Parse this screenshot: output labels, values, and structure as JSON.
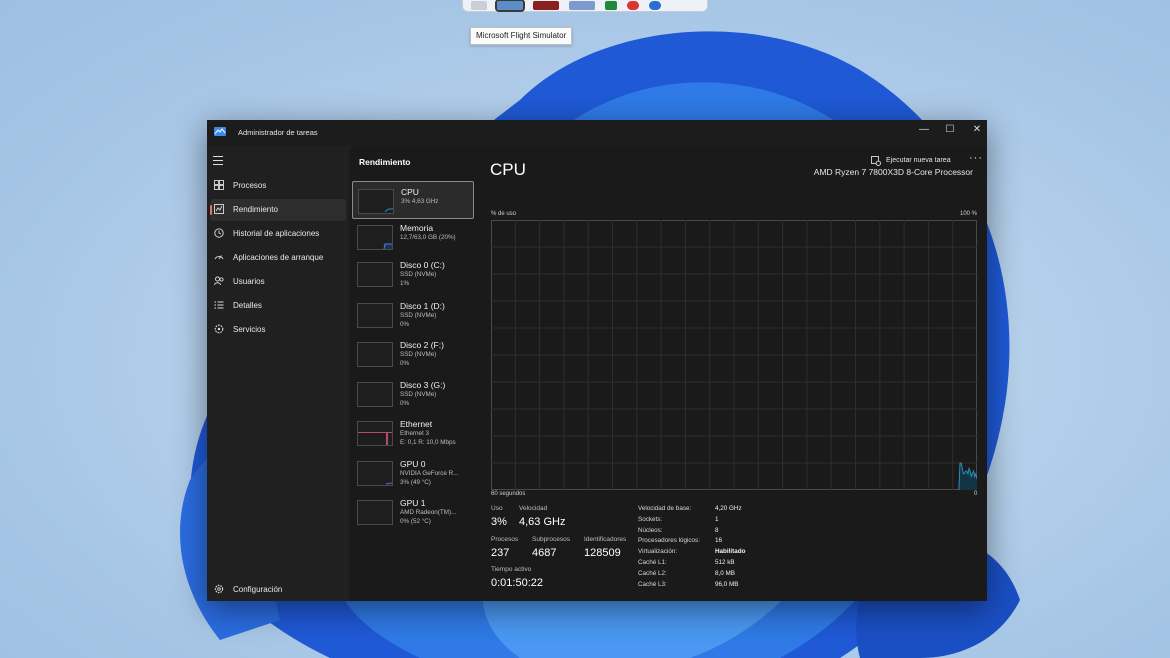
{
  "taskbar": {
    "tooltip": "Microsoft Flight Simulator"
  },
  "window": {
    "title": "Administrador de tareas",
    "controls": {
      "minimize": "—",
      "maximize": "☐",
      "close": "✕"
    }
  },
  "nav": {
    "items": [
      {
        "label": "Procesos",
        "icon": "processes-icon",
        "selected": false
      },
      {
        "label": "Rendimiento",
        "icon": "performance-icon",
        "selected": true
      },
      {
        "label": "Historial de aplicaciones",
        "icon": "history-icon",
        "selected": false
      },
      {
        "label": "Aplicaciones de arranque",
        "icon": "startup-icon",
        "selected": false
      },
      {
        "label": "Usuarios",
        "icon": "users-icon",
        "selected": false
      },
      {
        "label": "Detalles",
        "icon": "details-icon",
        "selected": false
      },
      {
        "label": "Servicios",
        "icon": "services-icon",
        "selected": false
      }
    ],
    "settings": {
      "label": "Configuración",
      "icon": "gear-icon"
    }
  },
  "content": {
    "page_title": "Rendimiento",
    "run_task": "Ejecutar nueva tarea",
    "more": "···"
  },
  "resources": [
    {
      "name": "CPU",
      "sub1": "3% 4,63 GHz",
      "sub2": ""
    },
    {
      "name": "Memoria",
      "sub1": "12,7/63,0 GB (20%)",
      "sub2": ""
    },
    {
      "name": "Disco 0 (C:)",
      "sub1": "SSD (NVMe)",
      "sub2": "1%"
    },
    {
      "name": "Disco 1 (D:)",
      "sub1": "SSD (NVMe)",
      "sub2": "0%"
    },
    {
      "name": "Disco 2 (F:)",
      "sub1": "SSD (NVMe)",
      "sub2": "0%"
    },
    {
      "name": "Disco 3 (G:)",
      "sub1": "SSD (NVMe)",
      "sub2": "0%"
    },
    {
      "name": "Ethernet",
      "sub1": "Ethernet 3",
      "sub2": "E: 0,1 R: 10,0 Mbps"
    },
    {
      "name": "GPU 0",
      "sub1": "NVIDIA GeForce R...",
      "sub2": "3% (49 °C)"
    },
    {
      "name": "GPU 1",
      "sub1": "AMD Radeon(TM)...",
      "sub2": "0% (52 °C)"
    }
  ],
  "cpu": {
    "title": "CPU",
    "model": "AMD Ryzen 7 7800X3D 8-Core Processor",
    "y_label": "% de uso",
    "y_max_label": "100 %",
    "x_left_label": "60 segundos",
    "x_right_label": "0",
    "usage_series": [
      0,
      0,
      0,
      0,
      0,
      0,
      0,
      0,
      0,
      0,
      0,
      0,
      0,
      0,
      0,
      0,
      0,
      0,
      0,
      0,
      0,
      0,
      0,
      0,
      0,
      0,
      0,
      0,
      0,
      0,
      0,
      0,
      0,
      0,
      0,
      0,
      0,
      0,
      0,
      0,
      0,
      0,
      0,
      0,
      0,
      0,
      0,
      0,
      0,
      0,
      0,
      0,
      0,
      0,
      0,
      0,
      0,
      0,
      0,
      0,
      0,
      0,
      0,
      0,
      0,
      0,
      0,
      0,
      0,
      0,
      0,
      0,
      0,
      0,
      0,
      0,
      0,
      0,
      0,
      0,
      0,
      0,
      0,
      0,
      0,
      0,
      0,
      0,
      0,
      0,
      0,
      0,
      0,
      0,
      0,
      0,
      0,
      0,
      0,
      0,
      0,
      0,
      0,
      0,
      0,
      0,
      0,
      0,
      0,
      0,
      0,
      0,
      0,
      0,
      0,
      0,
      0,
      0,
      0,
      0,
      0,
      0,
      0,
      0,
      0,
      0,
      0,
      0,
      0,
      0,
      0,
      0,
      0,
      0,
      0,
      0,
      0,
      0,
      0,
      0,
      0,
      0,
      0,
      0,
      0,
      0,
      0,
      0,
      0,
      0,
      0,
      0,
      0,
      0,
      0,
      0,
      0,
      0,
      0,
      0,
      0,
      0,
      0,
      0,
      0,
      0,
      0,
      0,
      0,
      0,
      0,
      0,
      0,
      0,
      0,
      0,
      0,
      0,
      0,
      0,
      0,
      0,
      0,
      0,
      0,
      0,
      0,
      0,
      0,
      0,
      0,
      0,
      0,
      0,
      0,
      0,
      0,
      0,
      0,
      0,
      0,
      0,
      0,
      0,
      0,
      0,
      0,
      0,
      0,
      0,
      0,
      0,
      0,
      0,
      0,
      0,
      0,
      0,
      0,
      0,
      0,
      0,
      0,
      0,
      0,
      0,
      0,
      0,
      0,
      0,
      0,
      0,
      0,
      0,
      0,
      0,
      0,
      0,
      0,
      0,
      0,
      0,
      0,
      0,
      0,
      0,
      0,
      0,
      0,
      0,
      0,
      0,
      0,
      0,
      0,
      0,
      0,
      0,
      0,
      0,
      0,
      0,
      0,
      0,
      0,
      0,
      0,
      0,
      0,
      0,
      0,
      0,
      0,
      0,
      0,
      0,
      0,
      0,
      0,
      0,
      0,
      0,
      0,
      0,
      0,
      0,
      0,
      0,
      0,
      0,
      0,
      0,
      0,
      0,
      0,
      0,
      0,
      0,
      0,
      0,
      0,
      0,
      0,
      0,
      0,
      0,
      0,
      0,
      0,
      0,
      0,
      0,
      0,
      0,
      0,
      0,
      0,
      0,
      0,
      0,
      0,
      0,
      0,
      0,
      0,
      0,
      0,
      0,
      0,
      0,
      0,
      0,
      0,
      0,
      0,
      0,
      0,
      0,
      0,
      0,
      0,
      0,
      0,
      0,
      0,
      0,
      0,
      0,
      0,
      0,
      0,
      0,
      0,
      0,
      0,
      0,
      0,
      0,
      0,
      0,
      0,
      0,
      0,
      0,
      0,
      0,
      0,
      0,
      0,
      0,
      0,
      0,
      0,
      0,
      0,
      0,
      0,
      0,
      0,
      0,
      0,
      0,
      0,
      0,
      0,
      0,
      0,
      0,
      0,
      0,
      0,
      0,
      0,
      0,
      0,
      0,
      0,
      0,
      0,
      0,
      0,
      0,
      0,
      0,
      0,
      0,
      0,
      0,
      0,
      0,
      0,
      0,
      0,
      0,
      10,
      10,
      8,
      6,
      6,
      7,
      7,
      6,
      8,
      7,
      5,
      6,
      7,
      5,
      6,
      4
    ],
    "usage_series_note_unused": "",
    "stats": {
      "uso_label": "Uso",
      "uso_value": "3%",
      "velocidad_label": "Velocidad",
      "velocidad_value": "4,63 GHz",
      "procesos_label": "Procesos",
      "procesos_value": "237",
      "subprocesos_label": "Subprocesos",
      "subprocesos_value": "4687",
      "identificadores_label": "Identificadores",
      "identificadores_value": "128509",
      "tiempo_label": "Tiempo activo",
      "tiempo_value": "0:01:50:22"
    },
    "specs": [
      {
        "k": "Velocidad de base:",
        "v": "4,20 GHz",
        "bold": false
      },
      {
        "k": "Sockets:",
        "v": "1",
        "bold": false
      },
      {
        "k": "Núcleos:",
        "v": "8",
        "bold": false
      },
      {
        "k": "Procesadores lógicos:",
        "v": "16",
        "bold": false
      },
      {
        "k": "Virtualización:",
        "v": "Habilitado",
        "bold": true
      },
      {
        "k": "Caché L1:",
        "v": "512 kB",
        "bold": false
      },
      {
        "k": "Caché L2:",
        "v": "8,0 MB",
        "bold": false
      },
      {
        "k": "Caché L3:",
        "v": "96,0 MB",
        "bold": false
      }
    ]
  },
  "colors": {
    "accent": "#e07a5f",
    "cpu_line": "#2a8fbd",
    "cpu_fill": "#123445",
    "grid": "#2e2e2e"
  }
}
